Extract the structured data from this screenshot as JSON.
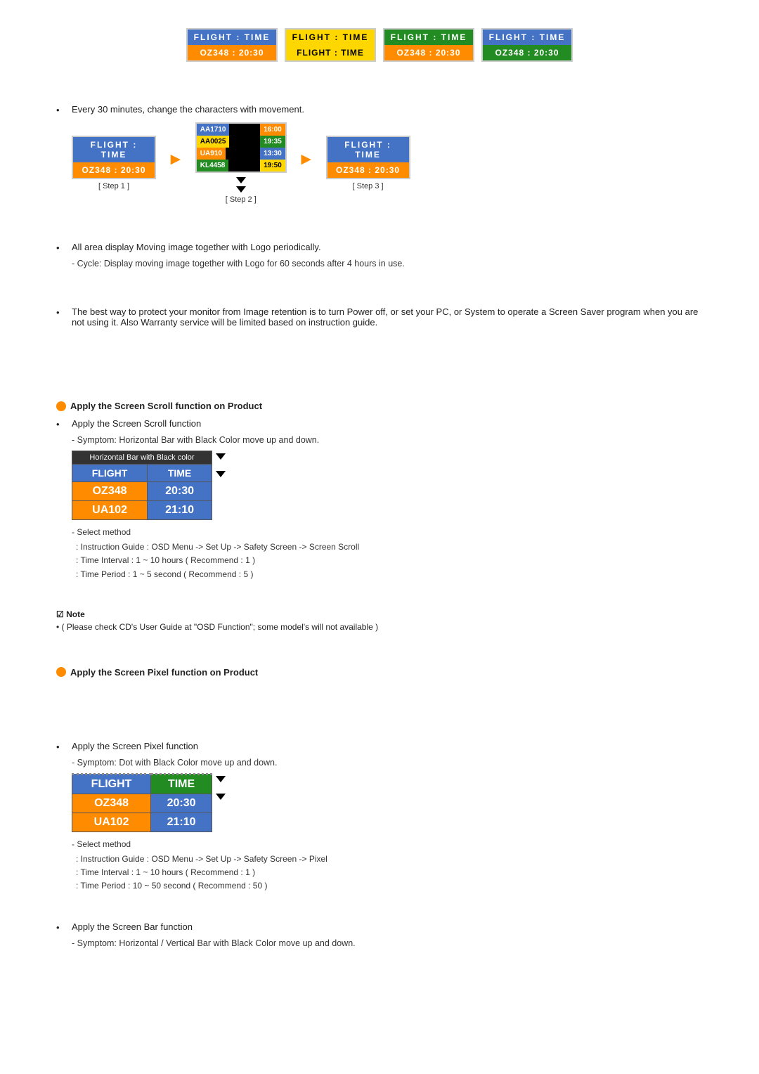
{
  "header": {
    "flight_label": "FLIGHT  :  TIME",
    "oz_label": "OZ348   :  20:30"
  },
  "cards": [
    {
      "top": "FLIGHT  :  TIME",
      "bottom": "OZ348   :  20:30",
      "topClass": "blue",
      "bottomClass": "orange"
    },
    {
      "top": "FLIGHT  :  TIME",
      "bottom": "FLIGHT  :  TIME",
      "topClass": "yellow",
      "bottomClass": "yellow"
    },
    {
      "top": "FLIGHT  :  TIME",
      "bottom": "OZ348   :  20:30",
      "topClass": "green",
      "bottomClass": "orange"
    },
    {
      "top": "FLIGHT  :  TIME",
      "bottom": "OZ348   :  20:30",
      "topClass": "blue",
      "bottomClass": "green"
    }
  ],
  "bullet1": {
    "text": "Every 30 minutes, change the characters with movement.",
    "step1_label": "[ Step 1 ]",
    "step2_label": "[ Step 2 ]",
    "step3_label": "[ Step 3 ]"
  },
  "bullet2": {
    "text": "All area display Moving image together with Logo periodically.",
    "sub": "- Cycle: Display moving image together with Logo for 60 seconds after 4 hours in use."
  },
  "bullet3": {
    "text": "The best way to protect your monitor from Image retention is to turn Power off, or set your PC, or System to operate a Screen Saver program when you are not using it.  Also Warranty service will be limited based on instruction guide."
  },
  "section1": {
    "title": "Apply the Screen Scroll function on Product",
    "bullet1_text": "Apply the Screen Scroll function",
    "bullet1_sub": "- Symptom: Horizontal Bar with Black Color move up and down.",
    "table_header": "Horizontal Bar with Black color",
    "table_row1": [
      "FLIGHT",
      "TIME"
    ],
    "table_row2": [
      "OZ348",
      "20:30"
    ],
    "table_row3": [
      "UA102",
      "21:10"
    ],
    "method_title": "- Select method",
    "method_line1": ": Instruction Guide : OSD Menu -> Set Up -> Safety Screen -> Screen Scroll",
    "method_line2": ": Time Interval : 1 ~ 10 hours ( Recommend : 1 )",
    "method_line3": ": Time Period : 1 ~ 5 second ( Recommend : 5 )"
  },
  "note": {
    "label": "☑ Note",
    "text": "•   ( Please check CD's User Guide at \"OSD Function\"; some model's will not available )"
  },
  "section2": {
    "title": "Apply the Screen Pixel function on Product",
    "bullet1_text": "Apply the Screen Pixel function",
    "bullet1_sub": "- Symptom: Dot with Black Color move up and down.",
    "table_row1": [
      "FLIGHT",
      "TIME"
    ],
    "table_row2": [
      "OZ348",
      "20:30"
    ],
    "table_row3": [
      "UA102",
      "21:10"
    ],
    "method_title": "- Select method",
    "method_line1": ": Instruction Guide : OSD Menu -> Set Up -> Safety Screen -> Pixel",
    "method_line2": ": Time Interval : 1 ~ 10 hours ( Recommend : 1 )",
    "method_line3": ": Time Period : 10 ~ 50 second ( Recommend : 50 )"
  },
  "section3": {
    "bullet1_text": "Apply the Screen Bar function",
    "bullet1_sub": "- Symptom: Horizontal / Vertical Bar with Black Color move up and down."
  }
}
